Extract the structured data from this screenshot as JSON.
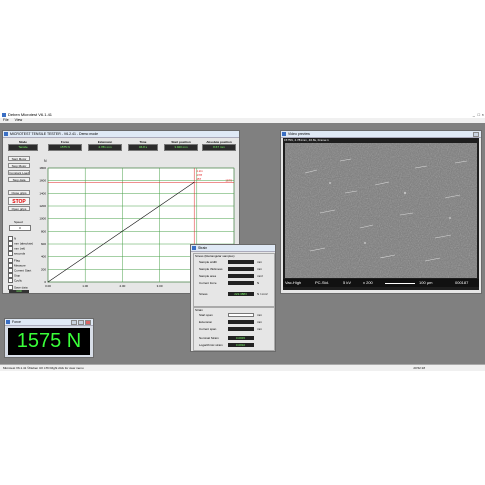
{
  "app": {
    "title": "Deben Microtest V6.1.41",
    "menu": [
      "File",
      "View"
    ]
  },
  "tester": {
    "title": "MICROTEST TENSILE TESTER - V6.2.41 - Demo mode",
    "headers": [
      {
        "label": "Mode",
        "value": "Tensile"
      },
      {
        "label": "Force",
        "value": "1575 N"
      },
      {
        "label": "Extension",
        "value": "4.781 mm"
      },
      {
        "label": "Time",
        "value": "46.8 s"
      },
      {
        "label": "Start position",
        "value": "3.920 mm"
      },
      {
        "label": "Absolute position",
        "value": "8.67 mm"
      }
    ],
    "buttons": [
      "Start Motor",
      "Stop Motor",
      "Constant Load",
      "Stop data"
    ],
    "close_grips": "Close grips",
    "stop_label": "STOP",
    "open_grips": "Open grips",
    "speed_label": "Speed",
    "speed_value": "0",
    "options": [
      "N",
      "mm (absolute)",
      "mm (rel)",
      "seconds",
      "Flag",
      "Measure",
      "Current Start",
      "Stop",
      "Cyclic"
    ],
    "save_label": "Save data",
    "save_value": "1000"
  },
  "chart_data": {
    "type": "line",
    "title": "",
    "xlabel": "",
    "ylabel": "N",
    "xlim": [
      0,
      5
    ],
    "ylim": [
      0,
      1800
    ],
    "x_ticks": [
      "0.00",
      "1.00",
      "2.00",
      "3.00",
      "4.00",
      "5.00"
    ],
    "y_ticks": [
      "0",
      "200",
      "400",
      "600",
      "800",
      "1000",
      "1200",
      "1400",
      "1600",
      "1800"
    ],
    "series": [
      {
        "x": [
          0,
          3.93
        ],
        "y": [
          0,
          1575
        ]
      }
    ],
    "crosshair": {
      "x": 3.93,
      "y": 1575,
      "labels": [
        "4.2m",
        "4/78",
        "457"
      ]
    },
    "limit": {
      "y": 1575,
      "label": "1575"
    }
  },
  "video": {
    "title": "Video preview",
    "caption": "1575N, 4.781mm, 46.8s, Frame:1",
    "overlay": [
      "Vac-High",
      "PC-Std.",
      "5 kV",
      "x 200",
      "100 µm",
      "000187"
    ]
  },
  "strain": {
    "title": "Strain",
    "sect1": "Stress (Rectangular samples)",
    "rows1": [
      {
        "label": "Sample width",
        "value": "",
        "unit": "mm"
      },
      {
        "label": "Sample thickness",
        "value": "",
        "unit": "mm"
      },
      {
        "label": "Sample area",
        "value": "",
        "unit": "mm²"
      },
      {
        "label": "Current force",
        "value": "",
        "unit": "N"
      }
    ],
    "stress_label": "Stress",
    "stress_value": "222.3883",
    "stress_unit": "N / mm²",
    "sect2": "Strain",
    "rows2": [
      {
        "label": "Start span",
        "value": "",
        "unit": "mm"
      },
      {
        "label": "Extension",
        "value": "",
        "unit": "mm"
      },
      {
        "label": "Current span",
        "value": "",
        "unit": "mm"
      }
    ],
    "nominal_label": "Nominal Strain",
    "nominal_value": "0.0845",
    "log_label": "Logarithmic strain",
    "log_value": "0.0810"
  },
  "force": {
    "title": "Force",
    "value": "1575 N"
  },
  "status": {
    "left": "Microtest V6.1.41 ©Deben UK LTD  Right click for view menu",
    "right": "20:52:18"
  }
}
